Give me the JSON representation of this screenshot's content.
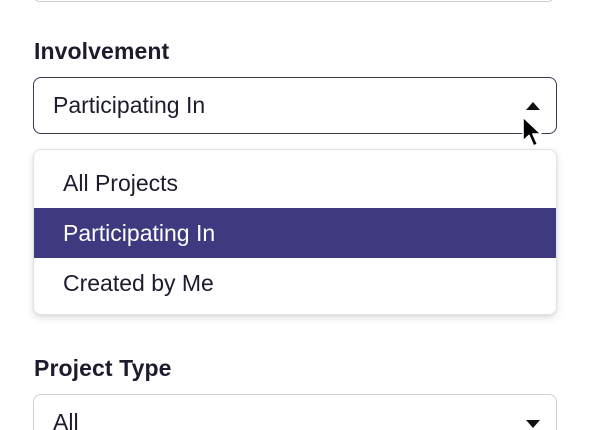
{
  "involvement": {
    "label": "Involvement",
    "selected_value": "Participating In",
    "options": [
      {
        "label": "All Projects"
      },
      {
        "label": "Participating In"
      },
      {
        "label": "Created by Me"
      }
    ],
    "selected_index": 1,
    "caret_icon": "caret-up-icon"
  },
  "project_type": {
    "label": "Project Type",
    "selected_value": "All",
    "caret_icon": "caret-down-icon"
  },
  "colors": {
    "selected_option_bg": "#3f3a80",
    "selected_option_text": "#ffffff",
    "active_border": "#3a3950",
    "inactive_border": "#cfd1d8"
  }
}
